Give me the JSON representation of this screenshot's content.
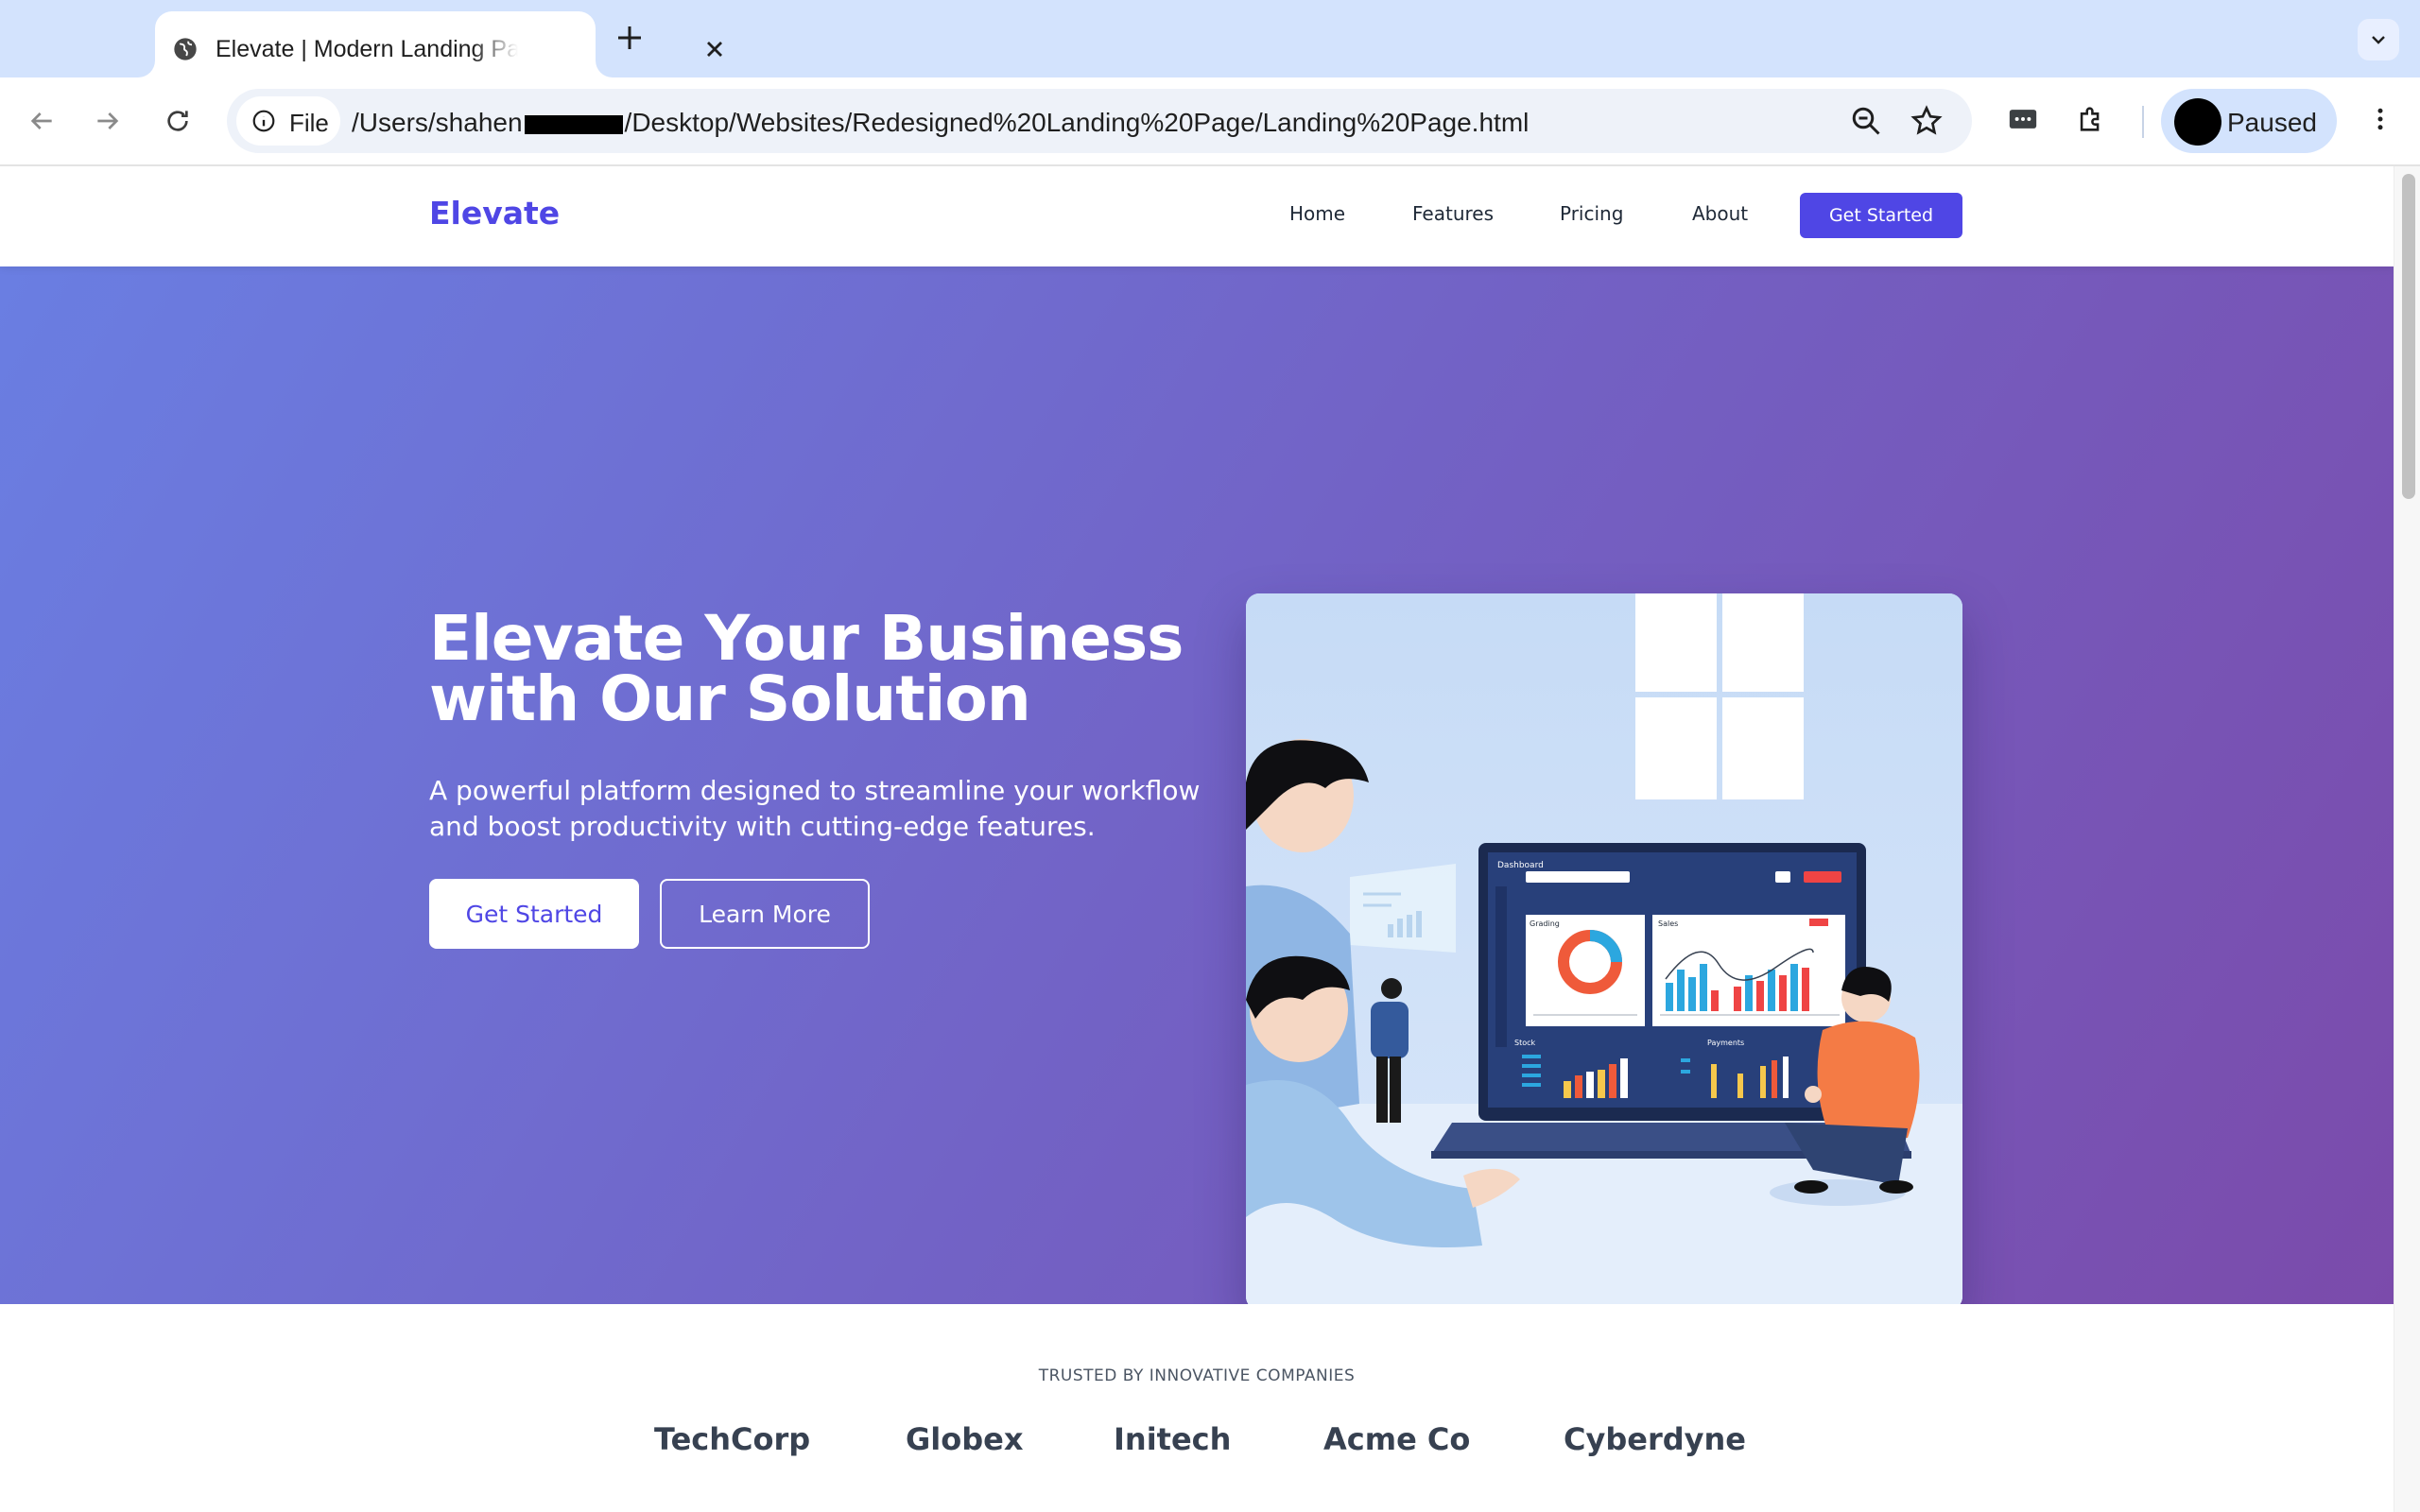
{
  "browser": {
    "tab_title": "Elevate | Modern Landing Page",
    "address_chip_label": "File",
    "url_prefix": "/Users/shahen",
    "url_suffix": "/Desktop/Websites/Redesigned%20Landing%20Page/Landing%20Page.html",
    "profile_status": "Paused"
  },
  "site": {
    "logo": "Elevate",
    "nav": [
      {
        "label": "Home"
      },
      {
        "label": "Features"
      },
      {
        "label": "Pricing"
      },
      {
        "label": "About"
      }
    ],
    "nav_cta": "Get Started"
  },
  "hero": {
    "title_line1": "Elevate Your Business",
    "title_line2": "with Our Solution",
    "subtitle_line1": "A powerful platform designed to streamline your workflow",
    "subtitle_line2": "and boost productivity with cutting-edge features.",
    "primary_button": "Get Started",
    "secondary_button": "Learn More",
    "illustration": {
      "dashboard_title": "Dashboard",
      "card_left_title": "Grading",
      "card_right_title": "Sales",
      "lower_left_title": "Stock",
      "lower_right_title": "Payments"
    }
  },
  "trusted": {
    "label": "TRUSTED BY INNOVATIVE COMPANIES",
    "companies": [
      "TechCorp",
      "Globex",
      "Initech",
      "Acme Co",
      "Cyberdyne"
    ]
  },
  "colors": {
    "brand": "#4f46e5",
    "hero_gradient_start": "#6a7ee2",
    "hero_gradient_end": "#7b4bab",
    "chrome_tabstrip": "#d3e3fd"
  }
}
